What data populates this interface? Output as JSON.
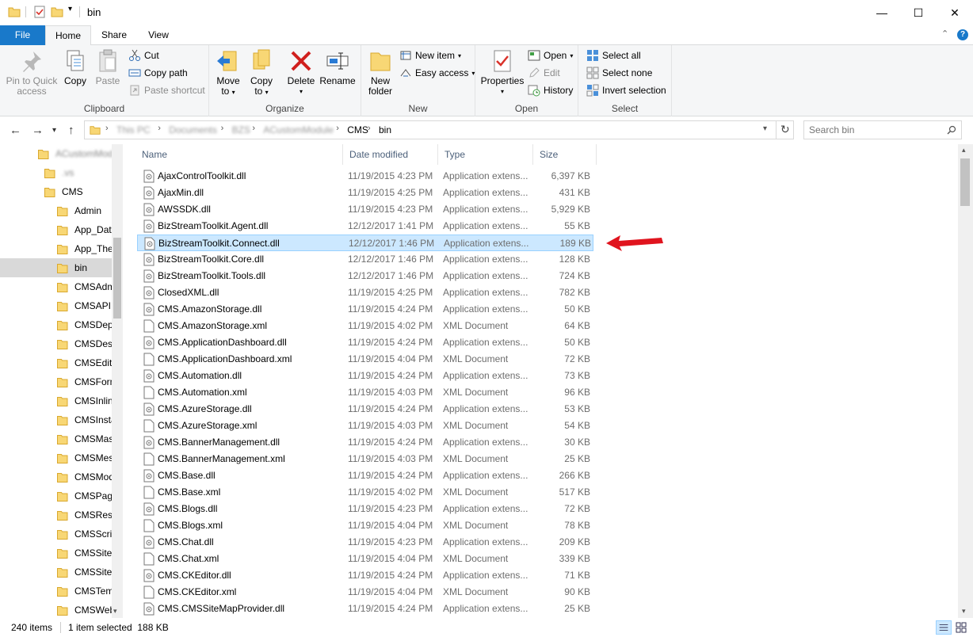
{
  "window": {
    "title": "bin",
    "minimize": "—",
    "maximize": "☐",
    "close": "✕"
  },
  "ribbon_tabs": {
    "file": "File",
    "home": "Home",
    "share": "Share",
    "view": "View"
  },
  "ribbon": {
    "clipboard": {
      "label": "Clipboard",
      "pin_line1": "Pin to Quick",
      "pin_line2": "access",
      "copy": "Copy",
      "paste": "Paste",
      "cut": "Cut",
      "copy_path": "Copy path",
      "paste_shortcut": "Paste shortcut"
    },
    "organize": {
      "label": "Organize",
      "move_to": "Move",
      "move_to2": "to",
      "copy_to": "Copy",
      "copy_to2": "to",
      "delete": "Delete",
      "rename": "Rename"
    },
    "new": {
      "label": "New",
      "new_folder1": "New",
      "new_folder2": "folder",
      "new_item": "New item",
      "easy_access": "Easy access"
    },
    "open": {
      "label": "Open",
      "properties": "Properties",
      "open": "Open",
      "edit": "Edit",
      "history": "History"
    },
    "select": {
      "label": "Select",
      "select_all": "Select all",
      "select_none": "Select none",
      "invert_selection": "Invert selection"
    }
  },
  "address": {
    "crumbs": [
      "This PC",
      "Documents",
      "BZS",
      "ACustomModule",
      "CMS",
      "bin"
    ]
  },
  "search": {
    "placeholder": "Search bin"
  },
  "nav_tree": [
    {
      "label": "ACustomModule",
      "indent": 0
    },
    {
      "label": ".vs",
      "indent": 1
    },
    {
      "label": "CMS",
      "indent": 1
    },
    {
      "label": "Admin",
      "indent": 2
    },
    {
      "label": "App_Data",
      "indent": 2
    },
    {
      "label": "App_Themes",
      "indent": 2
    },
    {
      "label": "bin",
      "indent": 2
    },
    {
      "label": "CMSAdminControls",
      "indent": 2
    },
    {
      "label": "CMSAPIExamples",
      "indent": 2
    },
    {
      "label": "CMSDependencies",
      "indent": 2
    },
    {
      "label": "CMSDesk",
      "indent": 2
    },
    {
      "label": "CMSEdit",
      "indent": 2
    },
    {
      "label": "CMSFormControls",
      "indent": 2
    },
    {
      "label": "CMSInlineControls",
      "indent": 2
    },
    {
      "label": "CMSInstall",
      "indent": 2
    },
    {
      "label": "CMSMasterPages",
      "indent": 2
    },
    {
      "label": "CMSMessages",
      "indent": 2
    },
    {
      "label": "CMSModules",
      "indent": 2
    },
    {
      "label": "CMSPages",
      "indent": 2
    },
    {
      "label": "CMSResources",
      "indent": 2
    },
    {
      "label": "CMSScripts",
      "indent": 2
    },
    {
      "label": "CMSSiteManager",
      "indent": 2
    },
    {
      "label": "CMSSiteUtils",
      "indent": 2
    },
    {
      "label": "CMSTemplateLayouts",
      "indent": 2
    },
    {
      "label": "CMSWebParts",
      "indent": 2
    }
  ],
  "columns": {
    "name": "Name",
    "date": "Date modified",
    "type": "Type",
    "size": "Size"
  },
  "files": [
    {
      "name": "AjaxControlToolkit.dll",
      "date": "11/19/2015 4:23 PM",
      "type": "Application extens...",
      "size": "6,397 KB",
      "kind": "dll"
    },
    {
      "name": "AjaxMin.dll",
      "date": "11/19/2015 4:25 PM",
      "type": "Application extens...",
      "size": "431 KB",
      "kind": "dll"
    },
    {
      "name": "AWSSDK.dll",
      "date": "11/19/2015 4:23 PM",
      "type": "Application extens...",
      "size": "5,929 KB",
      "kind": "dll"
    },
    {
      "name": "BizStreamToolkit.Agent.dll",
      "date": "12/12/2017 1:41 PM",
      "type": "Application extens...",
      "size": "55 KB",
      "kind": "dll"
    },
    {
      "name": "BizStreamToolkit.Connect.dll",
      "date": "12/12/2017 1:46 PM",
      "type": "Application extens...",
      "size": "189 KB",
      "kind": "dll"
    },
    {
      "name": "BizStreamToolkit.Core.dll",
      "date": "12/12/2017 1:46 PM",
      "type": "Application extens...",
      "size": "128 KB",
      "kind": "dll"
    },
    {
      "name": "BizStreamToolkit.Tools.dll",
      "date": "12/12/2017 1:46 PM",
      "type": "Application extens...",
      "size": "724 KB",
      "kind": "dll"
    },
    {
      "name": "ClosedXML.dll",
      "date": "11/19/2015 4:25 PM",
      "type": "Application extens...",
      "size": "782 KB",
      "kind": "dll"
    },
    {
      "name": "CMS.AmazonStorage.dll",
      "date": "11/19/2015 4:24 PM",
      "type": "Application extens...",
      "size": "50 KB",
      "kind": "dll"
    },
    {
      "name": "CMS.AmazonStorage.xml",
      "date": "11/19/2015 4:02 PM",
      "type": "XML Document",
      "size": "64 KB",
      "kind": "xml"
    },
    {
      "name": "CMS.ApplicationDashboard.dll",
      "date": "11/19/2015 4:24 PM",
      "type": "Application extens...",
      "size": "50 KB",
      "kind": "dll"
    },
    {
      "name": "CMS.ApplicationDashboard.xml",
      "date": "11/19/2015 4:04 PM",
      "type": "XML Document",
      "size": "72 KB",
      "kind": "xml"
    },
    {
      "name": "CMS.Automation.dll",
      "date": "11/19/2015 4:24 PM",
      "type": "Application extens...",
      "size": "73 KB",
      "kind": "dll"
    },
    {
      "name": "CMS.Automation.xml",
      "date": "11/19/2015 4:03 PM",
      "type": "XML Document",
      "size": "96 KB",
      "kind": "xml"
    },
    {
      "name": "CMS.AzureStorage.dll",
      "date": "11/19/2015 4:24 PM",
      "type": "Application extens...",
      "size": "53 KB",
      "kind": "dll"
    },
    {
      "name": "CMS.AzureStorage.xml",
      "date": "11/19/2015 4:03 PM",
      "type": "XML Document",
      "size": "54 KB",
      "kind": "xml"
    },
    {
      "name": "CMS.BannerManagement.dll",
      "date": "11/19/2015 4:24 PM",
      "type": "Application extens...",
      "size": "30 KB",
      "kind": "dll"
    },
    {
      "name": "CMS.BannerManagement.xml",
      "date": "11/19/2015 4:03 PM",
      "type": "XML Document",
      "size": "25 KB",
      "kind": "xml"
    },
    {
      "name": "CMS.Base.dll",
      "date": "11/19/2015 4:24 PM",
      "type": "Application extens...",
      "size": "266 KB",
      "kind": "dll"
    },
    {
      "name": "CMS.Base.xml",
      "date": "11/19/2015 4:02 PM",
      "type": "XML Document",
      "size": "517 KB",
      "kind": "xml"
    },
    {
      "name": "CMS.Blogs.dll",
      "date": "11/19/2015 4:23 PM",
      "type": "Application extens...",
      "size": "72 KB",
      "kind": "dll"
    },
    {
      "name": "CMS.Blogs.xml",
      "date": "11/19/2015 4:04 PM",
      "type": "XML Document",
      "size": "78 KB",
      "kind": "xml"
    },
    {
      "name": "CMS.Chat.dll",
      "date": "11/19/2015 4:23 PM",
      "type": "Application extens...",
      "size": "209 KB",
      "kind": "dll"
    },
    {
      "name": "CMS.Chat.xml",
      "date": "11/19/2015 4:04 PM",
      "type": "XML Document",
      "size": "339 KB",
      "kind": "xml"
    },
    {
      "name": "CMS.CKEditor.dll",
      "date": "11/19/2015 4:24 PM",
      "type": "Application extens...",
      "size": "71 KB",
      "kind": "dll"
    },
    {
      "name": "CMS.CKEditor.xml",
      "date": "11/19/2015 4:04 PM",
      "type": "XML Document",
      "size": "90 KB",
      "kind": "xml"
    },
    {
      "name": "CMS.CMSSiteMapProvider.dll",
      "date": "11/19/2015 4:24 PM",
      "type": "Application extens...",
      "size": "25 KB",
      "kind": "dll"
    }
  ],
  "selected_index": 4,
  "status": {
    "item_count": "240 items",
    "selection": "1 item selected  188 KB"
  },
  "colors": {
    "accent": "#1979ca",
    "selection_bg": "#cce8ff",
    "selection_border": "#99d1ff",
    "folder": "#f8d775",
    "arrow": "#e0141e"
  }
}
